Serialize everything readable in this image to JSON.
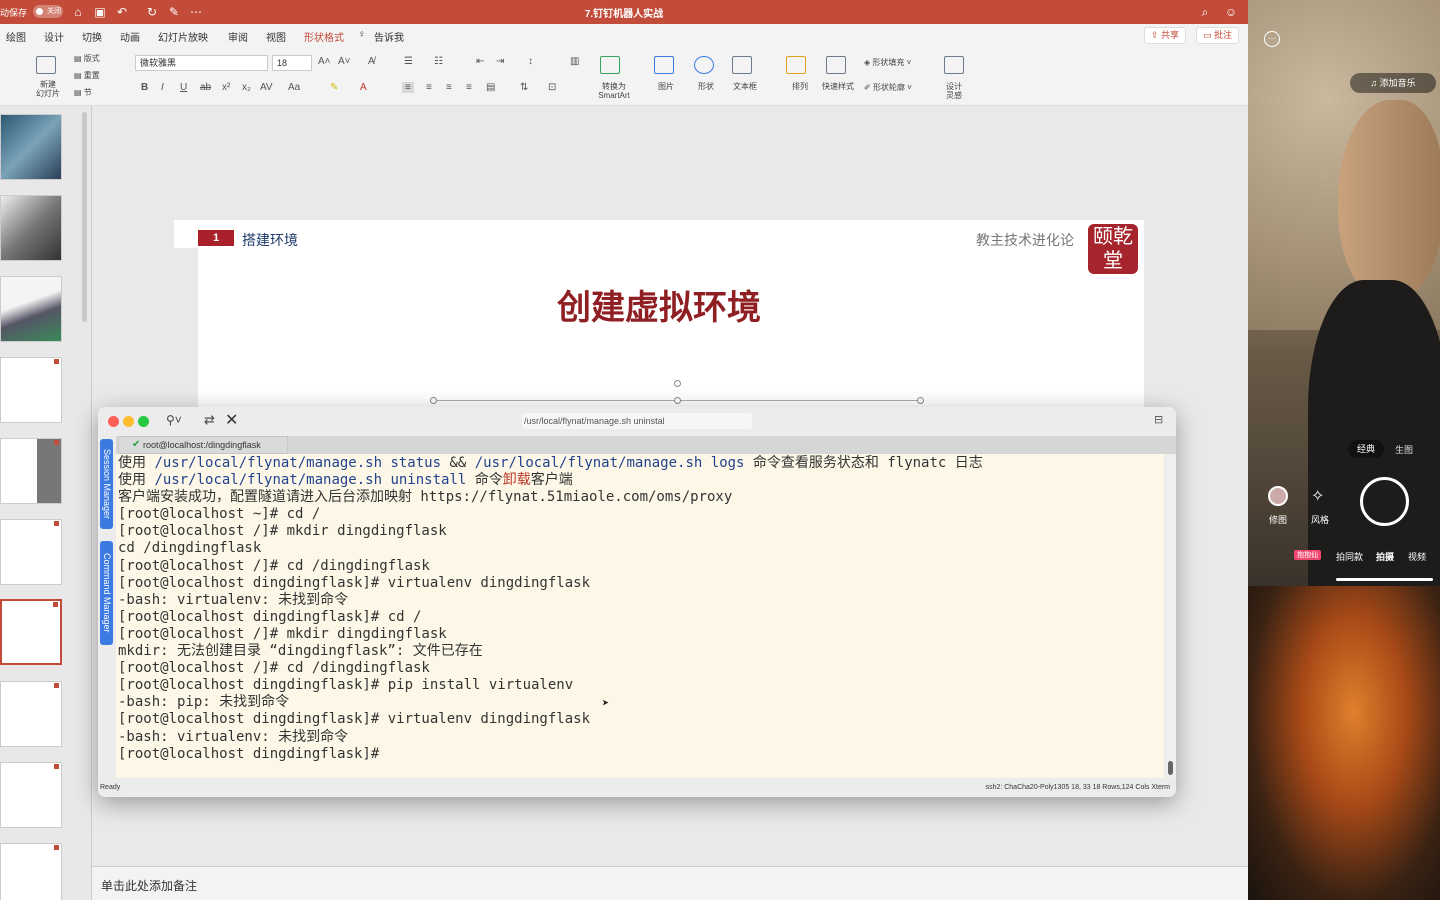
{
  "titlebar": {
    "autosave_label": "动保存",
    "autosave_state": "关闭",
    "doc_title": "7.钉钉机器人实战"
  },
  "tabs": [
    "绘图",
    "设计",
    "切换",
    "动画",
    "幻灯片放映",
    "审阅",
    "视图",
    "形状格式",
    "告诉我"
  ],
  "active_tab": "形状格式",
  "share_label": "共享",
  "comment_label": "批注",
  "ribbon": {
    "new_slide": "新建\n幻灯片",
    "layout": "版式",
    "reset": "重置",
    "section": "节",
    "font_name": "微软雅黑",
    "font_size": "18",
    "convert_smartart": "转换为\nSmartArt",
    "picture": "图片",
    "shape": "形状",
    "textbox": "文本框",
    "arrange": "排列",
    "quick_styles": "快速样式",
    "shape_fill": "形状填充",
    "shape_outline": "形状轮廓",
    "designer": "设计\n灵感"
  },
  "slide": {
    "section_number": "1",
    "section_title": "搭建环境",
    "author": "教主技术进化论",
    "seal_text": "颐乾\n堂",
    "title": "创建虚拟环境"
  },
  "notes_placeholder": "单击此处添加备注",
  "terminal": {
    "window_title": "/usr/local/flynat/manage.sh uninstal",
    "tab_label": "root@localhost:/dingdingflask",
    "side_tab_1": "Session Manager",
    "side_tab_2": "Command Manager",
    "lines": [
      "使用 /usr/local/flynat/manage.sh status && /usr/local/flynat/manage.sh logs 命令查看服务状态和 flynatc 日志",
      "使用 /usr/local/flynat/manage.sh uninstall 命令卸载客户端",
      "客户端安装成功，配置隧道请进入后台添加映射 https://flynat.51miaole.com/oms/proxy",
      "[root@localhost ~]# cd /",
      "[root@localhost /]# mkdir dingdingflask",
      "cd /dingdingflask",
      "[root@localhost /]# cd /dingdingflask",
      "[root@localhost dingdingflask]# virtualenv dingdingflask",
      "-bash: virtualenv: 未找到命令",
      "[root@localhost dingdingflask]# cd /",
      "[root@localhost /]# mkdir dingdingflask",
      "mkdir: 无法创建目录 “dingdingflask”: 文件已存在",
      "[root@localhost /]# cd /dingdingflask",
      "[root@localhost dingdingflask]# pip install virtualenv",
      "-bash: pip: 未找到命令",
      "[root@localhost dingdingflask]# virtualenv dingdingflask",
      "-bash: virtualenv: 未找到命令",
      "[root@localhost dingdingflask]#"
    ],
    "status_left": "Ready",
    "status_right": "ssh2: ChaCha20-Poly1305   18, 33   18 Rows,124 Cols   Xterm"
  },
  "phone": {
    "music_label": "添加音乐",
    "mode_classic": "经典",
    "mode_create": "生图",
    "retouch": "修图",
    "style": "风格",
    "modes": [
      "抱抱仙",
      "拍同款",
      "拍摄",
      "视频"
    ]
  },
  "colors": {
    "accent": "#c24c39",
    "slide_title": "#8f1f22",
    "terminal_bg": "#fcf7e6"
  }
}
